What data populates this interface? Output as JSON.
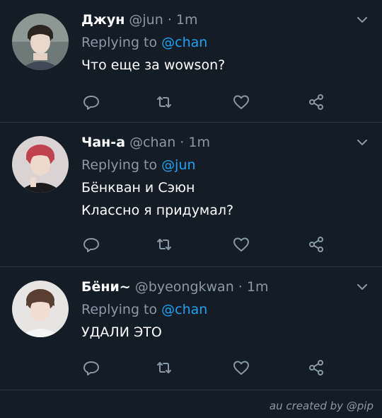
{
  "tweets": [
    {
      "name": "Джун",
      "handle": "@jun",
      "separator": "·",
      "time": "1m",
      "replying_label": "Replying to",
      "replying_to": "@chan",
      "lines": [
        "Что еще за wowson?"
      ],
      "avatar_icon": "avatar-photo"
    },
    {
      "name": "Чан-а",
      "handle": "@chan",
      "separator": "·",
      "time": "1m",
      "replying_label": "Replying to",
      "replying_to": "@jun",
      "lines": [
        "Бёнкван и Сэюн",
        "Классно я придумал?"
      ],
      "avatar_icon": "avatar-photo"
    },
    {
      "name": "Бёни~",
      "handle": "@byeongkwan",
      "separator": "·",
      "time": "1m",
      "replying_label": "Replying to",
      "replying_to": "@chan",
      "lines": [
        "УДАЛИ ЭТО"
      ],
      "avatar_icon": "avatar-photo"
    }
  ],
  "icons": {
    "reply": "reply-icon",
    "retweet": "retweet-icon",
    "like": "heart-icon",
    "share": "share-icon",
    "menu": "chevron-down-icon"
  },
  "colors": {
    "background": "#141d26",
    "divider": "#2a3845",
    "muted": "#8899a6",
    "accent": "#1da1f2",
    "text": "#ffffff"
  },
  "footer": {
    "credit": "au created by @pip"
  }
}
